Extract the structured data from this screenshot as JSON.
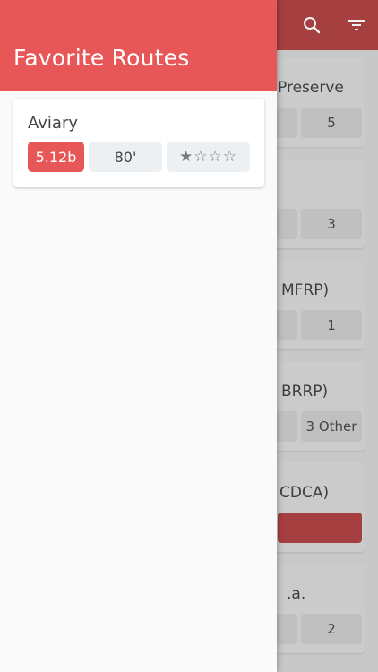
{
  "background": {
    "cards": [
      {
        "title": "Preserve",
        "left_chip": "",
        "count": "5"
      },
      {
        "title": "",
        "left_chip": "",
        "count": "3"
      },
      {
        "title": "MFRP)",
        "left_chip": "",
        "count": "1"
      },
      {
        "title": "BRRP)",
        "left_chip": "",
        "count": "3 Other"
      },
      {
        "title": "CDCA)",
        "left_chip": "",
        "count": ""
      },
      {
        "title": ".a.",
        "left_chip": "",
        "count": "2"
      }
    ]
  },
  "drawer": {
    "title": "Favorite Routes",
    "routes": [
      {
        "name": "Aviary",
        "grade": "5.12b",
        "height": "80'",
        "stars": "★☆☆☆",
        "rating": 1,
        "rating_max": 4
      }
    ]
  },
  "colors": {
    "accent": "#e85757",
    "header_dimmed": "#a63f3f",
    "chip_bg": "#edf0f3"
  },
  "icons": {
    "search": "search-icon",
    "filter": "filter-icon"
  }
}
